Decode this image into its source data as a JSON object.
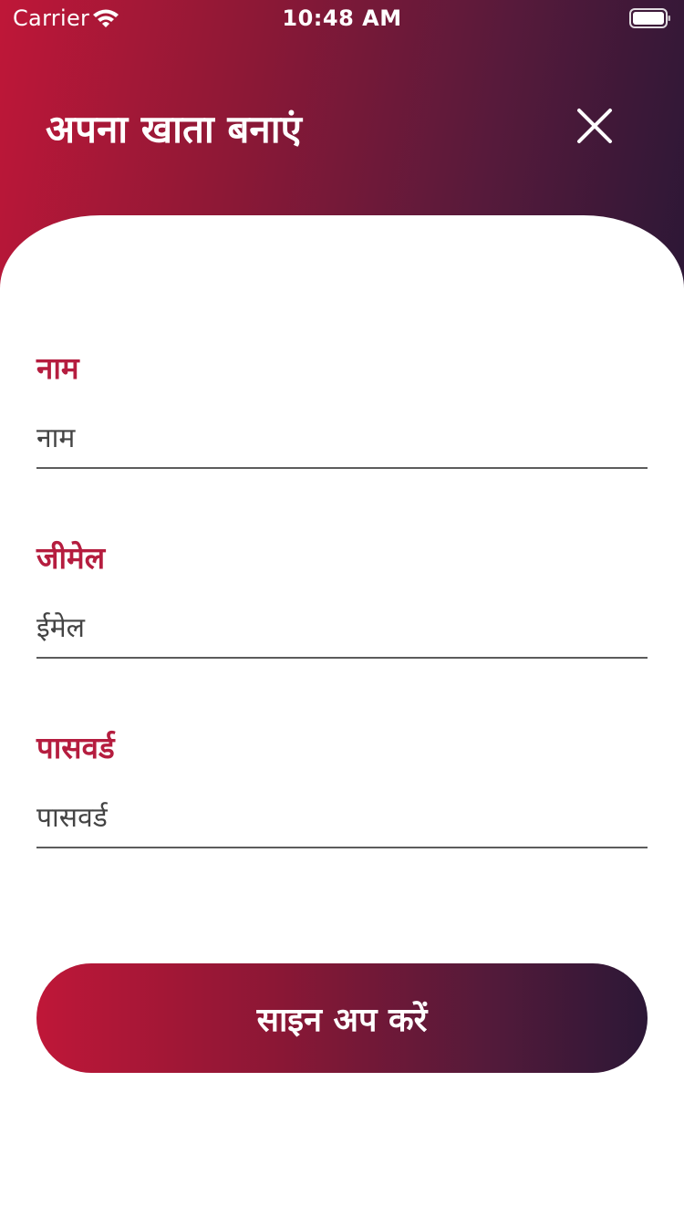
{
  "status_bar": {
    "carrier": "Carrier",
    "time": "10:48 AM",
    "wifi_icon": "wifi-icon",
    "battery_icon": "battery-icon"
  },
  "header": {
    "title": "अपना खाता बनाएं",
    "close_icon": "close-icon"
  },
  "form": {
    "name": {
      "label": "नाम",
      "value": "",
      "placeholder": "नाम"
    },
    "email": {
      "label": "जीमेल",
      "value": "",
      "placeholder": "ईमेल"
    },
    "password": {
      "label": "पासवर्ड",
      "value": "",
      "placeholder": "पासवर्ड"
    }
  },
  "signup_button": {
    "label": "साइन अप करें"
  },
  "colors": {
    "gradient_start": "#bf1738",
    "gradient_end": "#2c1736",
    "label_accent": "#b51d3f"
  }
}
